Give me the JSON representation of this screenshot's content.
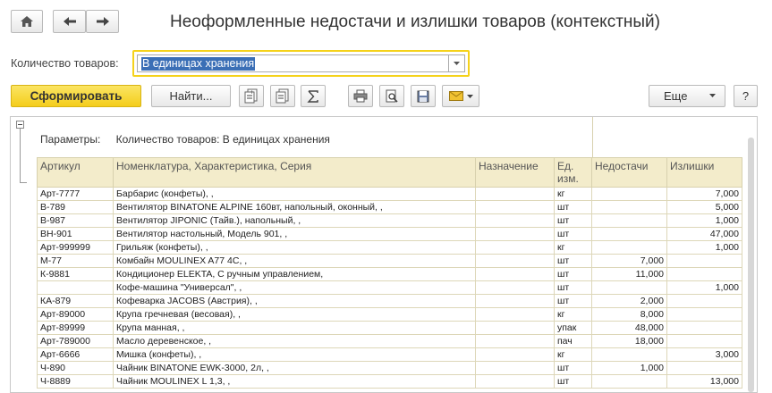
{
  "window": {
    "title": "Неоформленные недостачи и излишки товаров (контекстный)"
  },
  "toolbar_top": {
    "home_icon": "home-icon",
    "back_icon": "arrow-left-icon",
    "forward_icon": "arrow-right-icon"
  },
  "quantity": {
    "label": "Количество товаров:",
    "value": "В единицах хранения"
  },
  "actions": {
    "generate_label": "Сформировать",
    "find_label": "Найти...",
    "more_label": "Еще",
    "help_label": "?"
  },
  "report": {
    "params_label": "Параметры:",
    "params_value": "Количество товаров: В единицах хранения",
    "columns": [
      "Артикул",
      "Номенклатура, Характеристика, Серия",
      "Назначение",
      "Ед. изм.",
      "Недостачи",
      "Излишки"
    ],
    "rows": [
      [
        "Арт-7777",
        "Барбарис (конфеты), ,",
        "",
        "кг",
        "",
        "7,000"
      ],
      [
        "В-789",
        "Вентилятор BINATONE ALPINE 160вт, напольный, оконный, ,",
        "",
        "шт",
        "",
        "5,000"
      ],
      [
        "В-987",
        "Вентилятор JIPONIC (Тайв.), напольный, ,",
        "",
        "шт",
        "",
        "1,000"
      ],
      [
        "ВН-901",
        "Вентилятор настольный, Модель 901, ,",
        "",
        "шт",
        "",
        "47,000"
      ],
      [
        "Арт-999999",
        "Грильяж (конфеты), ,",
        "",
        "кг",
        "",
        "1,000"
      ],
      [
        "М-77",
        "Комбайн MOULINEX A77 4C, ,",
        "",
        "шт",
        "7,000",
        ""
      ],
      [
        "К-9881",
        "Кондиционер ELEKTA, С ручным управлением,",
        "",
        "шт",
        "11,000",
        ""
      ],
      [
        "",
        "Кофе-машина \"Универсал\", ,",
        "",
        "шт",
        "",
        "1,000"
      ],
      [
        "КА-879",
        "Кофеварка JACOBS (Австрия), ,",
        "",
        "шт",
        "2,000",
        ""
      ],
      [
        "Арт-89000",
        "Крупа гречневая (весовая), ,",
        "",
        "кг",
        "8,000",
        ""
      ],
      [
        "Арт-89999",
        "Крупа манная, ,",
        "",
        "упак",
        "48,000",
        ""
      ],
      [
        "Арт-789000",
        "Масло деревенское, ,",
        "",
        "пач",
        "18,000",
        ""
      ],
      [
        "Арт-6666",
        "Мишка (конфеты), ,",
        "",
        "кг",
        "",
        "3,000"
      ],
      [
        "Ч-890",
        "Чайник BINATONE EWK-3000, 2л, ,",
        "",
        "шт",
        "1,000",
        ""
      ],
      [
        "Ч-8889",
        "Чайник MOULINEX L 1,3, ,",
        "",
        "шт",
        "",
        "13,000"
      ]
    ]
  },
  "colors": {
    "accent_yellow": "#f4cd1b",
    "header_bg": "#f3eccb",
    "selection": "#3b6fb6"
  }
}
